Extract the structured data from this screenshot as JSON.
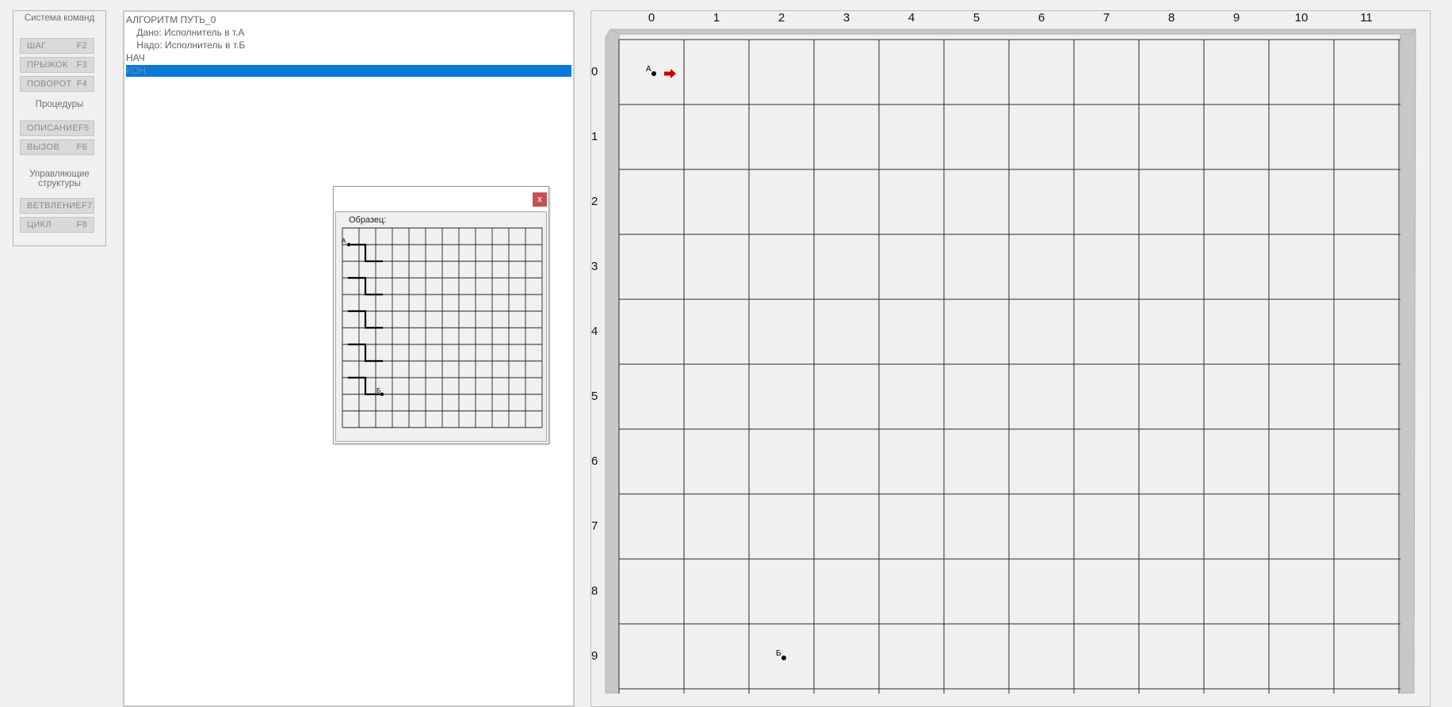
{
  "panel": {
    "group_commands": "Система команд",
    "btn_step": {
      "label": "ШАГ",
      "key": "F2"
    },
    "btn_jump": {
      "label": "ПРЫЖОК",
      "key": "F3"
    },
    "btn_turn": {
      "label": "ПОВОРОТ",
      "key": "F4"
    },
    "group_procedures": "Процедуры",
    "btn_describe": {
      "label": "ОПИСАНИЕ",
      "key": "F5"
    },
    "btn_call": {
      "label": "ВЫЗОВ",
      "key": "F6"
    },
    "group_control": "Управляющие структуры",
    "btn_branch": {
      "label": "ВЕТВЛЕНИЕ",
      "key": "F7"
    },
    "btn_loop": {
      "label": "ЦИКЛ",
      "key": "F8"
    }
  },
  "editor": {
    "lines": [
      "АЛГОРИТМ ПУТЬ_0",
      "    Дано: Исполнитель в т.А",
      "    Надо: Исполнитель в т.Б",
      "НАЧ",
      "КОН"
    ]
  },
  "sample_dialog": {
    "close_label": "x",
    "label": "Образец:",
    "point_a": "А",
    "point_b": "Б"
  },
  "field": {
    "columns": [
      "0",
      "1",
      "2",
      "3",
      "4",
      "5",
      "6",
      "7",
      "8",
      "9",
      "10",
      "11"
    ],
    "rows": [
      "0",
      "1",
      "2",
      "3",
      "4",
      "5",
      "6",
      "7",
      "8",
      "9"
    ],
    "point_a": {
      "label": "А",
      "cell": [
        0,
        0
      ]
    },
    "point_b": {
      "label": "Б",
      "cell": [
        2,
        9
      ]
    },
    "executor_direction": "right",
    "colors": {
      "arrow": "#cc0000",
      "selection": "#0a78d7"
    }
  }
}
